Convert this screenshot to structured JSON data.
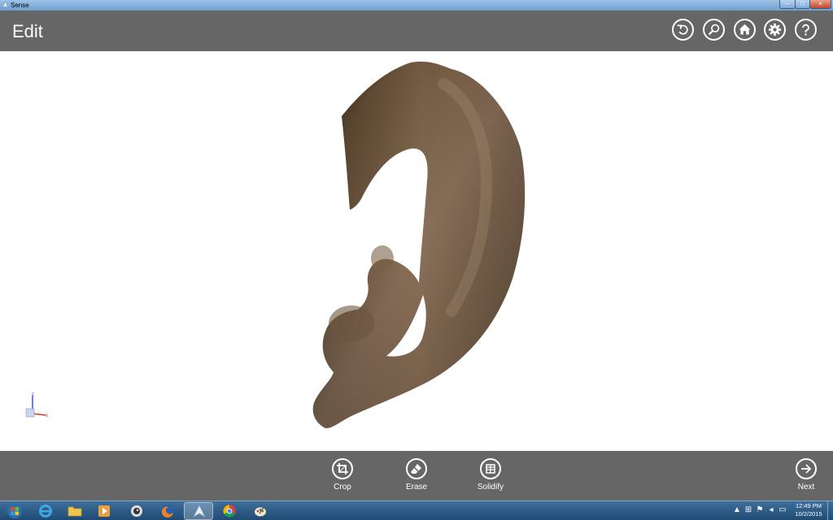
{
  "window": {
    "title": "Sense",
    "controls": {
      "minimize": "–",
      "maximize": "□",
      "close": "×"
    }
  },
  "header": {
    "title": "Edit",
    "buttons": [
      {
        "name": "undo",
        "icon": "undo-icon"
      },
      {
        "name": "zoom",
        "icon": "zoom-icon"
      },
      {
        "name": "home",
        "icon": "home-icon"
      },
      {
        "name": "settings",
        "icon": "gear-icon"
      },
      {
        "name": "help",
        "icon": "help-icon"
      }
    ]
  },
  "axes": {
    "z": "z",
    "x": "x",
    "y": "y"
  },
  "toolbar": {
    "crop_label": "Crop",
    "erase_label": "Erase",
    "solidify_label": "Solidify",
    "next_label": "Next"
  },
  "taskbar": {
    "items": [
      {
        "name": "start-button",
        "icon": "windows-logo-icon"
      },
      {
        "name": "internet-explorer",
        "icon": "ie-icon"
      },
      {
        "name": "file-explorer",
        "icon": "folder-icon"
      },
      {
        "name": "media-player",
        "icon": "media-player-icon"
      },
      {
        "name": "app-eye",
        "icon": "eye-icon"
      },
      {
        "name": "firefox",
        "icon": "firefox-icon"
      },
      {
        "name": "sense",
        "icon": "sense-icon",
        "active": true
      },
      {
        "name": "chrome",
        "icon": "chrome-icon"
      },
      {
        "name": "paint",
        "icon": "paint-icon"
      }
    ],
    "clock_time": "12:49 PM",
    "clock_date": "10/2/2015"
  },
  "colors": {
    "bar": "#666666",
    "canvas": "#ffffff",
    "model_skin": "#7a6248",
    "model_dark": "#3d2a1a"
  }
}
